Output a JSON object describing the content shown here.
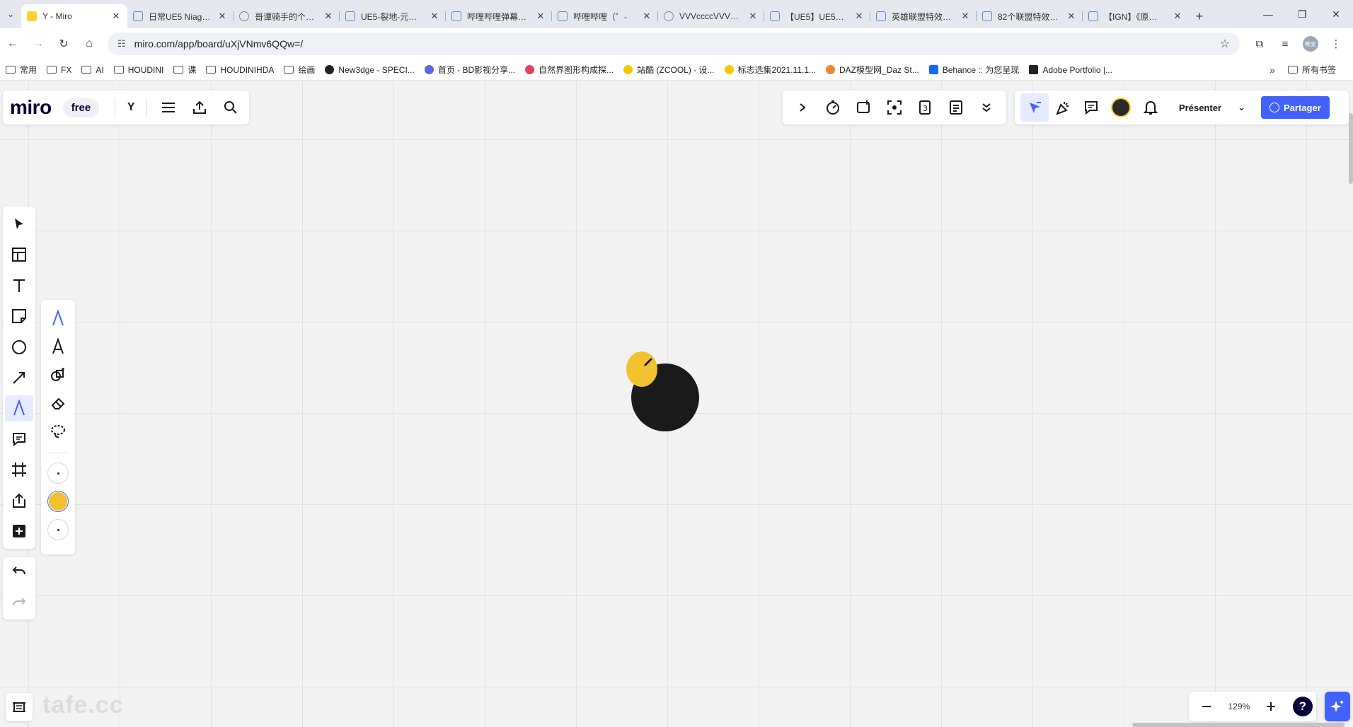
{
  "browser": {
    "tabs": [
      {
        "title": "Y - Miro",
        "active": true,
        "icon": "miro"
      },
      {
        "title": "日常UE5 Niag…"
      },
      {
        "title": "哥谭骑手的个…"
      },
      {
        "title": "UE5-裂地-元…"
      },
      {
        "title": "哔哩哔哩弹幕…"
      },
      {
        "title": "哔哩哔哩（゜-"
      },
      {
        "title": "VVVccccVVV…"
      },
      {
        "title": "【UE5】UE5…"
      },
      {
        "title": "英雄联盟特效…"
      },
      {
        "title": "82个联盟特效…"
      },
      {
        "title": "【IGN】《原…"
      }
    ],
    "new_tab": "+",
    "url": "miro.com/app/board/uXjVNmv6QQw=/",
    "profile_label": "晚安",
    "bookmarks": [
      {
        "label": "常用",
        "type": "folder"
      },
      {
        "label": "FX",
        "type": "folder"
      },
      {
        "label": "AI",
        "type": "folder"
      },
      {
        "label": "HOUDINI",
        "type": "folder"
      },
      {
        "label": "课",
        "type": "folder"
      },
      {
        "label": "HOUDINIHDA",
        "type": "folder"
      },
      {
        "label": "绘画",
        "type": "folder"
      },
      {
        "label": "New3dge - SPECI...",
        "type": "site",
        "color": "#222222"
      },
      {
        "label": "首页 - BD影视分享...",
        "type": "site",
        "color": "#5a6bd8"
      },
      {
        "label": "自然界图形构成探...",
        "type": "site",
        "color": "#e0445a"
      },
      {
        "label": "站酷 (ZCOOL) - 设...",
        "type": "site",
        "color": "#f5c800"
      },
      {
        "label": "标志选集2021.11.1...",
        "type": "site",
        "color": "#f5c800"
      },
      {
        "label": "DAZ模型网_Daz St...",
        "type": "site",
        "color": "#e8893a"
      },
      {
        "label": "Behance :: 为您呈现",
        "type": "site",
        "color": "#1769ff"
      },
      {
        "label": "Adobe Portfolio |...",
        "type": "site",
        "color": "#222222"
      }
    ],
    "more_bookmarks": "»",
    "all_bookmarks": "所有书签"
  },
  "miro": {
    "logo": "miro",
    "plan_badge": "free",
    "board_name": "Y",
    "present_label": "Présenter",
    "share_label": "Partager",
    "zoom_level": "129%",
    "help_label": "?",
    "watermark": "tafe.cc",
    "colors": {
      "accent": "#4262ff",
      "yellow": "#f2c12e",
      "dark_shape": "#1a1a1a"
    },
    "left_tools": [
      "select-icon",
      "templates-icon",
      "text-icon",
      "sticky-note-icon",
      "shape-icon",
      "connector-icon",
      "pen-icon",
      "comment-icon",
      "frame-icon",
      "upload-icon",
      "more-tools-icon"
    ],
    "pen_tools": [
      "pen-icon",
      "highlighter-icon",
      "smart-drawing-icon",
      "eraser-icon",
      "lasso-icon"
    ],
    "pen_swatches": [
      "thin-stroke",
      "yellow",
      "thin-stroke-2"
    ]
  }
}
